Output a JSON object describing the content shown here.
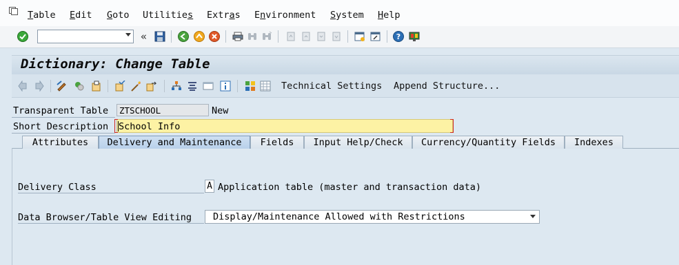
{
  "menubar": {
    "items": [
      {
        "label": "Table",
        "underline": "T",
        "rest": "able"
      },
      {
        "label": "Edit",
        "underline": "E",
        "rest": "dit"
      },
      {
        "label": "Goto",
        "underline": "G",
        "rest": "oto"
      },
      {
        "label": "Utilities",
        "pre": "Utilitie",
        "underline": "s",
        "rest": ""
      },
      {
        "label": "Extras",
        "pre": "Extr",
        "underline": "a",
        "rest": "s"
      },
      {
        "label": "Environment",
        "pre": "E",
        "underline": "n",
        "rest": "vironment"
      },
      {
        "label": "System",
        "underline": "S",
        "rest": "ystem"
      },
      {
        "label": "Help",
        "underline": "H",
        "rest": "elp"
      }
    ]
  },
  "toolbar": {
    "command_field_value": "",
    "back_glyph": "«"
  },
  "title": "Dictionary: Change Table",
  "app_toolbar": {
    "technical_settings": "Technical Settings",
    "append_structure": "Append Structure..."
  },
  "header": {
    "transparent_table_label": "Transparent Table",
    "table_name": "ZTSCHOOL",
    "status": "New",
    "short_description_label": "Short Description",
    "short_description": "School Info"
  },
  "tabs": [
    {
      "label": "Attributes",
      "active": false
    },
    {
      "label": "Delivery and Maintenance",
      "active": true
    },
    {
      "label": "Fields",
      "active": false
    },
    {
      "label": "Input Help/Check",
      "active": false
    },
    {
      "label": "Currency/Quantity Fields",
      "active": false
    },
    {
      "label": "Indexes",
      "active": false
    }
  ],
  "delivery": {
    "delivery_class_label": "Delivery Class",
    "delivery_class_value": "A",
    "delivery_class_text": "Application table (master and transaction data)",
    "browser_label": "Data Browser/Table View Editing",
    "browser_value": "Display/Maintenance Allowed with Restrictions"
  },
  "colors": {
    "background": "#dde8f1",
    "required_field": "#fdf2a4",
    "required_marker": "#d02a1e",
    "active_tab": "#b8d0ea"
  }
}
